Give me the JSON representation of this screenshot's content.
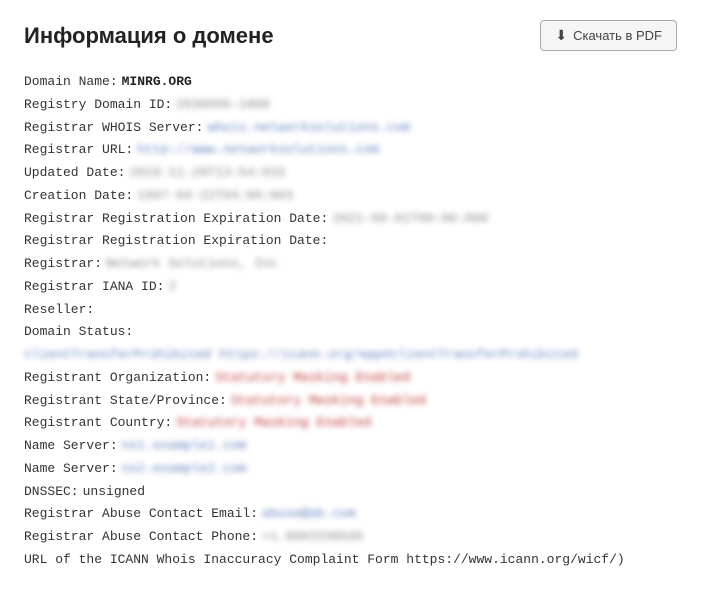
{
  "header": {
    "title": "Информация о домене",
    "download_button": "Скачать в PDF"
  },
  "whois": {
    "domain_name_label": "Domain Name:",
    "domain_name_value": "MINRG.ORG",
    "registry_id_label": "Registry Domain ID:",
    "registry_id_value": "2038096-1808",
    "registrar_whois_label": "Registrar WHOIS Server:",
    "registrar_whois_value": "whois.networksolutions.com",
    "registrar_url_label": "Registrar URL:",
    "registrar_url_value": "http://www.networksolutions.com",
    "updated_date_label": "Updated Date:",
    "updated_date_value": "2019-11-20T13:54:033",
    "creation_date_label": "Creation Date:",
    "creation_date_value": "1997-04-22T04:00:003",
    "expiration_date_label1": "Registrar Registration Expiration Date:",
    "expiration_date_value1": "2021-09-01T00:00:000",
    "expiration_date_label2": "Registrar Registration Expiration Date:",
    "registrar_label": "Registrar:",
    "registrar_value": "Network Solutions, Inc",
    "iana_id_label": "Registrar IANA ID:",
    "iana_id_value": "2",
    "reseller_label": "Reseller:",
    "domain_status_label": "Domain Status:",
    "domain_status_value": "clientTransferProhibited https://icann.org/epp#clientTransferProhibited",
    "registrant_org_label": "Registrant Organization:",
    "registrant_org_value": "Statutory Masking Enabled",
    "registrant_state_label": "Registrant State/Province:",
    "registrant_state_value": "Statutory Masking Enabled",
    "registrant_country_label": "Registrant Country:",
    "registrant_country_value": "Statutory Masking Enabled",
    "name_server1_label": "Name Server:",
    "name_server1_value": "ns1.example1.com",
    "name_server2_label": "Name Server:",
    "name_server2_value": "ns2.example2.com",
    "dnssec_label": "DNSSEC:",
    "dnssec_value": "unsigned",
    "abuse_email_label": "Registrar Abuse Contact Email:",
    "abuse_email_value": "abuse@ab.com",
    "abuse_phone_label": "Registrar Abuse Contact Phone:",
    "abuse_phone_value": "+1.8003338595",
    "icann_url_label": "URL of the ICANN Whois Inaccuracy Complaint Form https://www.icann.org/wicf/)"
  }
}
